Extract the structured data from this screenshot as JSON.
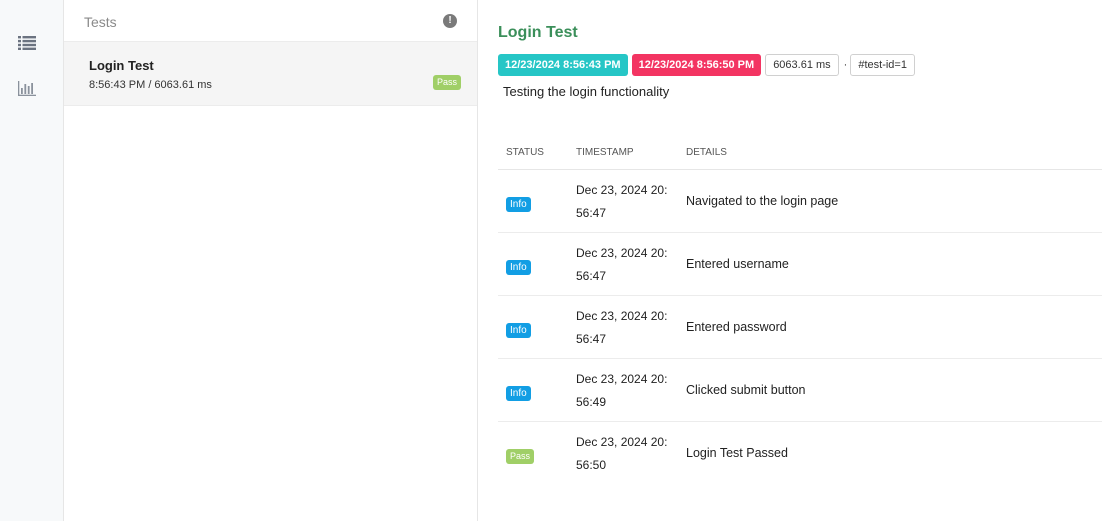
{
  "nav": {
    "items": [
      {
        "icon": "list-icon"
      },
      {
        "icon": "bar-chart-icon"
      }
    ]
  },
  "tests_panel": {
    "title": "Tests",
    "warning_glyph": "!",
    "tests": [
      {
        "name": "Login Test",
        "meta": "8:56:43 PM / 6063.61 ms",
        "status": "Pass"
      }
    ]
  },
  "detail": {
    "title": "Login Test",
    "start_time": "12/23/2024 8:56:43 PM",
    "end_time": "12/23/2024 8:56:50 PM",
    "duration": "6063.61 ms",
    "separator": "·",
    "test_id": "#test-id=1",
    "description": "Testing the login functionality",
    "columns": {
      "status": "Status",
      "timestamp": "Timestamp",
      "details": "Details"
    },
    "logs": [
      {
        "status": "Info",
        "time_line1": "Dec 23, 2024 20:",
        "time_line2": "56:47",
        "details": "Navigated to the login page"
      },
      {
        "status": "Info",
        "time_line1": "Dec 23, 2024 20:",
        "time_line2": "56:47",
        "details": "Entered username"
      },
      {
        "status": "Info",
        "time_line1": "Dec 23, 2024 20:",
        "time_line2": "56:47",
        "details": "Entered password"
      },
      {
        "status": "Info",
        "time_line1": "Dec 23, 2024 20:",
        "time_line2": "56:49",
        "details": "Clicked submit button"
      },
      {
        "status": "Pass",
        "time_line1": "Dec 23, 2024 20:",
        "time_line2": "56:50",
        "details": "Login Test Passed"
      }
    ]
  },
  "colors": {
    "title_green": "#3b8f5a",
    "start_tag": "#26c6c6",
    "end_tag": "#f33462",
    "info_badge": "#129ee4",
    "pass_badge": "#a0cf67"
  }
}
